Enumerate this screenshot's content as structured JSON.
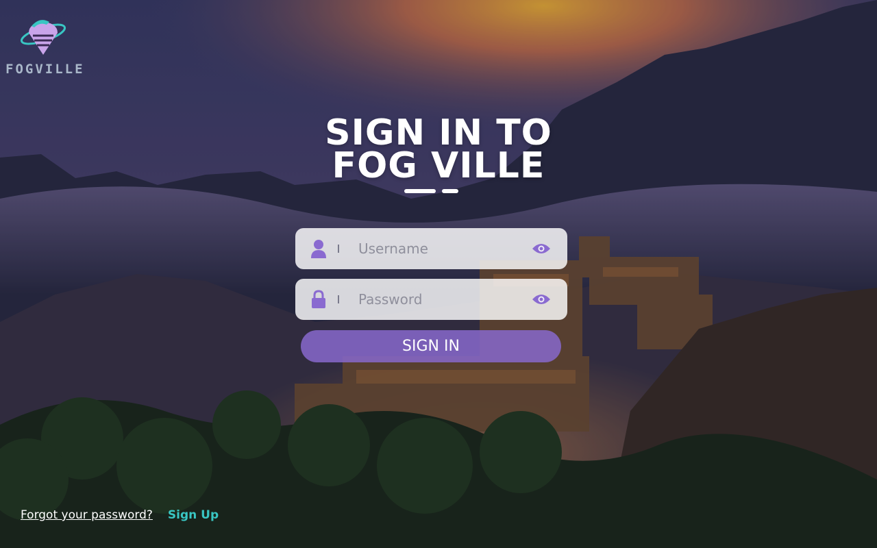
{
  "brand": {
    "name": "FOGVILLE"
  },
  "heading": {
    "line1": "SIGN IN TO",
    "line2": "FOG VILLE"
  },
  "form": {
    "username": {
      "placeholder": "Username",
      "value": "",
      "icon": "user-icon",
      "toggle_icon": "eye-icon"
    },
    "password": {
      "placeholder": "Password",
      "value": "",
      "icon": "lock-icon",
      "toggle_icon": "eye-icon"
    },
    "submit_label": "SIGN IN"
  },
  "links": {
    "forgot": "Forgot your password?",
    "signup": "Sign Up"
  },
  "colors": {
    "accent": "#8a6ad0",
    "signup_link": "#39c6c3",
    "field_bg": "#f0eef6"
  }
}
